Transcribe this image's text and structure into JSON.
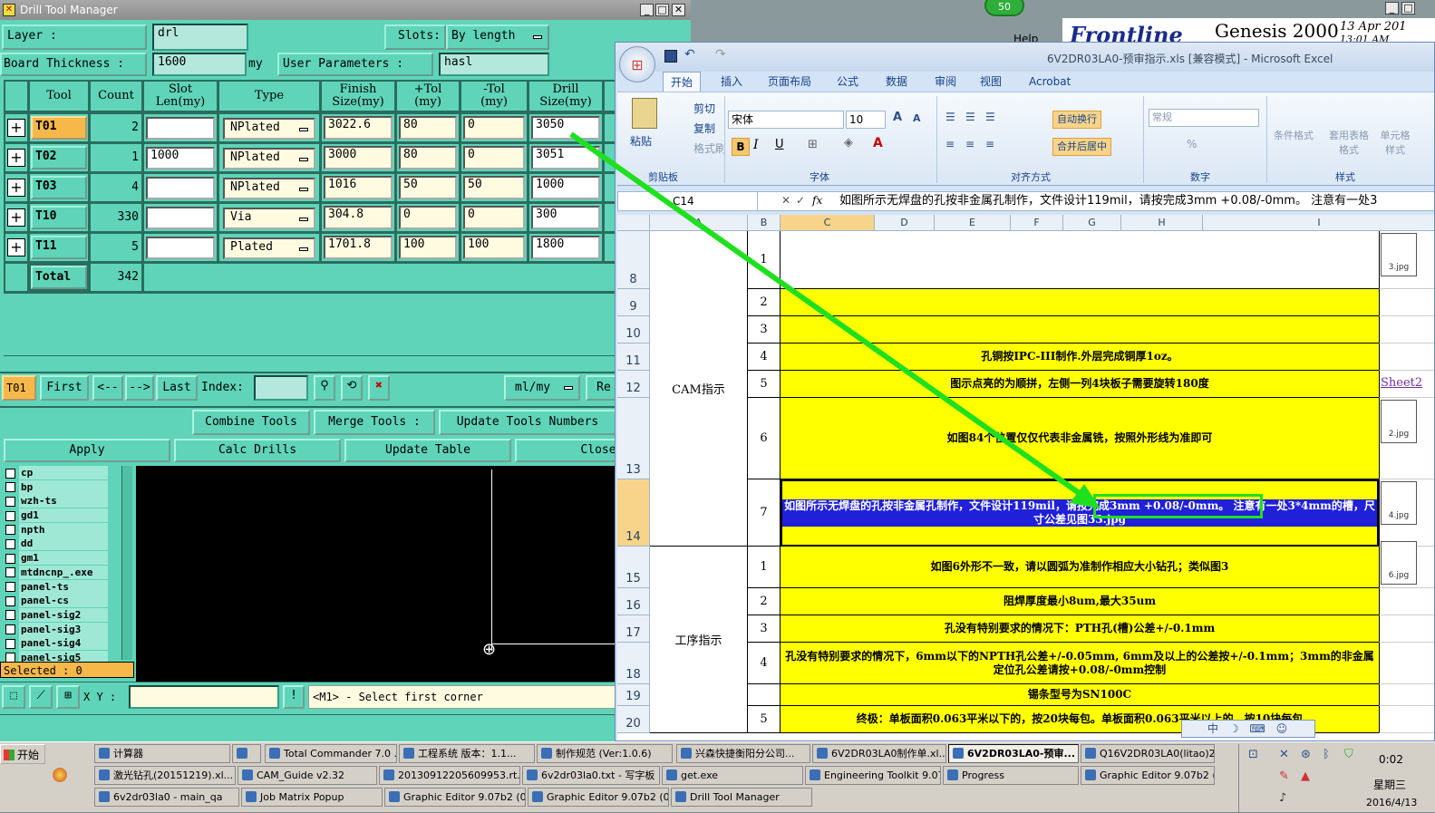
{
  "bg_window": {
    "badge": "50",
    "help": "Help",
    "frontline": "Frontline",
    "genesis": "Genesis 2000",
    "date": "13 Apr 201",
    "time": "13:01 AM"
  },
  "dtm": {
    "title": "Drill Tool Manager",
    "layer_label": "Layer          :",
    "layer_value": "drl",
    "slots_label": "Slots:",
    "slots_value": "By length",
    "board_thickness_label": "Board Thickness :",
    "board_thickness_value": "1600",
    "board_unit": "my",
    "user_params_label": "User Parameters :",
    "user_params_value": "hasl",
    "headers": [
      "Tool",
      "Count",
      "Slot Len(my)",
      "Type",
      "Finish Size(my)",
      "+Tol (my)",
      "-Tol (my)",
      "Drill Size(my)"
    ],
    "rows": [
      {
        "tool": "T01",
        "count": "2",
        "slot": "",
        "type": "NPlated",
        "finish": "3022.6",
        "ptol": "80",
        "mtol": "0",
        "drill": "3050"
      },
      {
        "tool": "T02",
        "count": "1",
        "slot": "1000",
        "type": "NPlated",
        "finish": "3000",
        "ptol": "80",
        "mtol": "0",
        "drill": "3051"
      },
      {
        "tool": "T03",
        "count": "4",
        "slot": "",
        "type": "NPlated",
        "finish": "1016",
        "ptol": "50",
        "mtol": "50",
        "drill": "1000"
      },
      {
        "tool": "T10",
        "count": "330",
        "slot": "",
        "type": "Via",
        "finish": "304.8",
        "ptol": "0",
        "mtol": "0",
        "drill": "300"
      },
      {
        "tool": "T11",
        "count": "5",
        "slot": "",
        "type": "Plated",
        "finish": "1701.8",
        "ptol": "100",
        "mtol": "100",
        "drill": "1800"
      }
    ],
    "total_label": "Total",
    "total_count": "342",
    "nav_tool": "T01",
    "nav_first": "First",
    "nav_prev": "<--",
    "nav_next": "-->",
    "nav_last": "Last",
    "index_label": "Index:",
    "unit_select": "ml/my",
    "re_btn": "Re",
    "combine": "Combine Tools",
    "merge": "Merge Tools :",
    "update_numbers": "Update Tools Numbers",
    "apply": "Apply",
    "calc": "Calc Drills",
    "update_table": "Update Table",
    "close": "Close",
    "layers": [
      "cp",
      "bp",
      "wzh-ts",
      "gd1",
      "npth",
      "dd",
      "gm1",
      "mtdncnp_.exe",
      "panel-ts",
      "panel-cs",
      "panel-sig2",
      "panel-sig3",
      "panel-sig4",
      "panel-sig5"
    ],
    "selected": "Selected : 0",
    "xy_label": "X Y :",
    "status": "<M1> - Select first corner"
  },
  "excel": {
    "title": "6V2DR03LA0-预审指示.xls [兼容模式] - Microsoft Excel",
    "tabs": [
      "开始",
      "插入",
      "页面布局",
      "公式",
      "数据",
      "审阅",
      "视图",
      "Acrobat"
    ],
    "clipboard": {
      "paste": "粘贴",
      "cut": "剪切",
      "copy": "复制",
      "format_painter": "格式刷",
      "group": "剪贴板"
    },
    "font": {
      "name": "宋体",
      "size": "10",
      "group": "字体"
    },
    "align": {
      "wrap": "自动换行",
      "merge": "合并后居中",
      "group": "对齐方式"
    },
    "number": {
      "format": "常规",
      "group": "数字"
    },
    "styles": {
      "cond": "条件格式",
      "table": "套用表格格式",
      "cell": "单元格样式",
      "group": "样式"
    },
    "namebox": "C14",
    "formula": "如图所示无焊盘的孔按非金属孔制作，文件设计119mil，请按完成3mm +0.08/-0mm。 注意有一处3",
    "columns": [
      "A",
      "B",
      "C",
      "D",
      "E",
      "F",
      "G",
      "H",
      "I"
    ],
    "rows": [
      {
        "rownum": "8",
        "num": "1",
        "text": ""
      },
      {
        "rownum": "9",
        "num": "2",
        "text": ""
      },
      {
        "rownum": "10",
        "num": "3",
        "text": ""
      },
      {
        "rownum": "11",
        "num": "4",
        "text": "孔铜按IPC-III制作.外层完成铜厚1oz。"
      },
      {
        "rownum": "12",
        "num": "5",
        "text": "图示点亮的为顺拼，左侧一列4块板子需要旋转180度"
      },
      {
        "rownum": "13",
        "num": "6",
        "text": "如图84个位置仅仅代表非金属铣，按照外形线为准即可"
      },
      {
        "rownum": "14",
        "num": "7",
        "text": "如图所示无焊盘的孔按非金属孔制作，文件设计119mil，请按完成3mm +0.08/-0mm。 注意有一处3*4mm的槽，尺寸公差见图33.jpg"
      },
      {
        "rownum": "15",
        "num": "1",
        "text": "如图6外形不一致，请以圆弧为准制作相应大小钻孔；类似图3"
      },
      {
        "rownum": "16",
        "num": "2",
        "text": "阻焊厚度最小8um,最大35um"
      },
      {
        "rownum": "17",
        "num": "3",
        "text": "孔没有特别要求的情况下：PTH孔(槽)公差+/-0.1mm"
      },
      {
        "rownum": "18",
        "num": "4",
        "text": "孔没有特别要求的情况下，6mm以下的NPTH孔公差+/-0.05mm, 6mm及以上的公差按+/-0.1mm；3mm的非金属定位孔公差请按+0.08/-0mm控制"
      },
      {
        "rownum": "19",
        "num": "",
        "text": "锡条型号为SN100C"
      },
      {
        "rownum": "20",
        "num": "5",
        "text": "终极：单板面积0.063平米以下的，按20块每包。单板面积0.063平米以上的，按10块每包"
      }
    ],
    "section_cam": "CAM指示",
    "section_process": "工序指示",
    "sheet_link": "Sheet2",
    "images": [
      "3.jpg",
      "2.jpg",
      "4.jpg",
      "6.jpg"
    ],
    "ime": "中"
  },
  "taskbar": {
    "start": "开始",
    "row1": [
      "计算器",
      "",
      "Total Commander 7.0 ...",
      "工程系统  版本：1.1...",
      "制作规范 (Ver:1.0.6)",
      "兴森快捷衡阳分公司...",
      "6V2DR03LA0制作单.xl...",
      "6V2DR03LA0-预审...",
      "Q16V2DR03LA0(litao)2..."
    ],
    "row2": [
      "激光钻孔(20151219).xl...",
      "CAM_Guide v2.32",
      "20130912205609953.rt...",
      "6v2dr03la0.txt - 写字板",
      "get.exe",
      "Engineering Toolkit 9.07...",
      "Progress",
      "Graphic Editor 9.07b2 (..."
    ],
    "row3": [
      "6v2dr03la0 - main_qa",
      "Job Matrix Popup",
      "Graphic Editor 9.07b2 (0...",
      "Graphic Editor 9.07b2 (0...",
      "Drill Tool Manager"
    ],
    "clock_time": "0:02",
    "clock_day": "星期三",
    "clock_date": "2016/4/13"
  }
}
